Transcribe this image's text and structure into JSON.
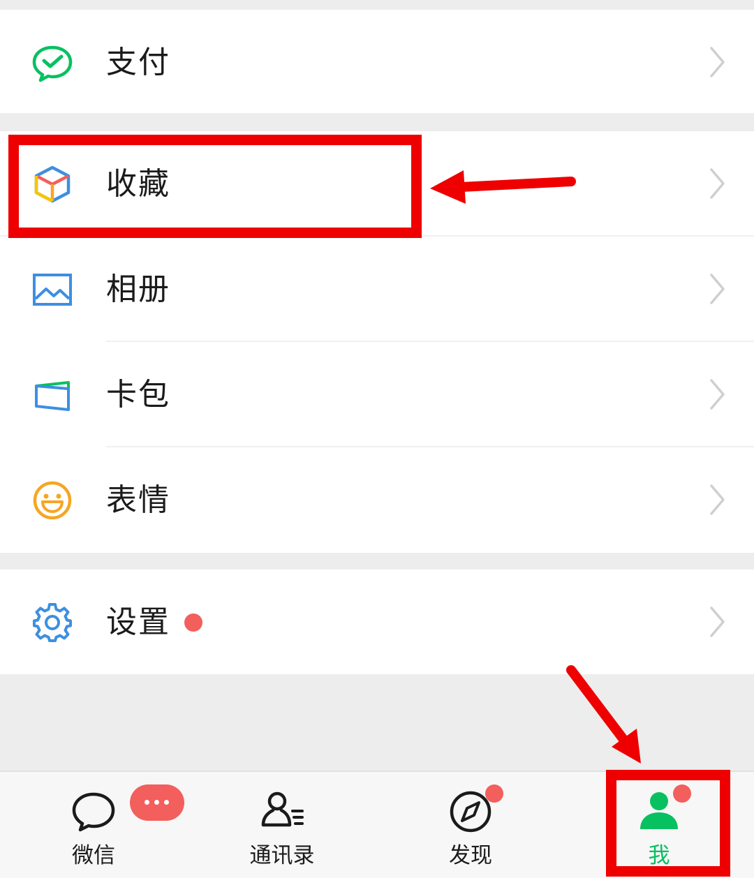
{
  "menu": {
    "pay": "支付",
    "favorites": "收藏",
    "album": "相册",
    "cards": "卡包",
    "stickers": "表情",
    "settings": "设置"
  },
  "tabs": {
    "chats": "微信",
    "contacts": "通讯录",
    "discover": "发现",
    "me": "我"
  },
  "colors": {
    "brand_green": "#07c160",
    "badge_red": "#f25f5c",
    "annotation_red": "#ee0000",
    "icon_blue": "#3d8fe0",
    "icon_orange": "#f5a623"
  },
  "annotations": {
    "highlight": [
      "favorites-row",
      "me-tab"
    ]
  }
}
